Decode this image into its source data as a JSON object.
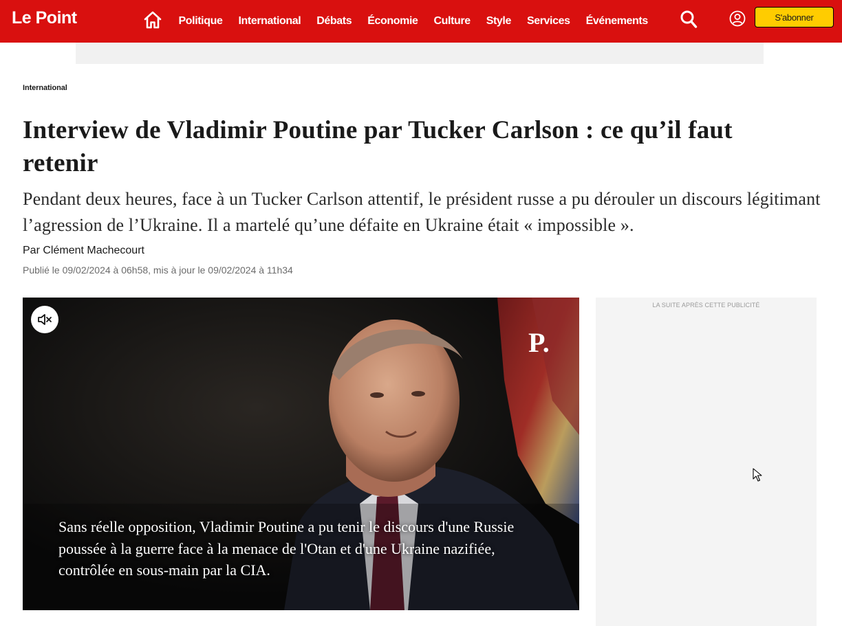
{
  "header": {
    "logo": "Le Point",
    "nav": [
      "Politique",
      "International",
      "Débats",
      "Économie",
      "Culture",
      "Style",
      "Services",
      "Événements"
    ],
    "subscribe_label": "S'abonner",
    "brand_color": "#d9100f",
    "subscribe_color": "#ffcc00",
    "icons": [
      "home-icon",
      "search-icon",
      "account-icon"
    ]
  },
  "article": {
    "rubric": "International",
    "title": "Interview de Vladimir Poutine par Tucker Carlson : ce qu’il faut retenir",
    "standfirst": "Pendant deux heures, face à un Tucker Carlson attentif, le président russe a pu dérouler un discours légitimant l’agression de l’Ukraine. Il a martelé qu’une défaite en Ukraine était « impossible ».",
    "author_prefix": "Par",
    "author": "Clément Machecourt",
    "dates": "Publié le 09/02/2024 à 06h58, mis à jour le 09/02/2024 à 11h34"
  },
  "video": {
    "watermark": "P.",
    "caption": "Sans réelle opposition, Vladimir Poutine a pu tenir le discours d'une Russie poussée à la guerre face à la menace de l'Otan et d'une Ukraine nazifiée, contrôlée en sous-main par la CIA.",
    "mute_icon": "muted-speaker-icon"
  },
  "sidebar": {
    "ad_label": "LA SUITE APRÈS CETTE PUBLICITÉ"
  }
}
